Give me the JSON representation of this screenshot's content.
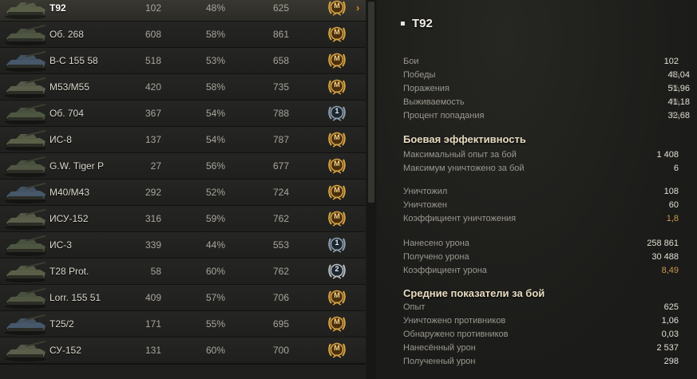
{
  "tanks": [
    {
      "name": "T92",
      "battles": "102",
      "wins": "48%",
      "xp": "625",
      "badge": "M"
    },
    {
      "name": "Об. 268",
      "battles": "608",
      "wins": "58%",
      "xp": "861",
      "badge": "M"
    },
    {
      "name": "В-С 155 58",
      "battles": "518",
      "wins": "53%",
      "xp": "658",
      "badge": "M"
    },
    {
      "name": "M53/M55",
      "battles": "420",
      "wins": "58%",
      "xp": "735",
      "badge": "M"
    },
    {
      "name": "Об. 704",
      "battles": "367",
      "wins": "54%",
      "xp": "788",
      "badge": "1"
    },
    {
      "name": "ИС-8",
      "battles": "137",
      "wins": "54%",
      "xp": "787",
      "badge": "M"
    },
    {
      "name": "G.W. Tiger P",
      "battles": "27",
      "wins": "56%",
      "xp": "677",
      "badge": "M"
    },
    {
      "name": "M40/M43",
      "battles": "292",
      "wins": "52%",
      "xp": "724",
      "badge": "M"
    },
    {
      "name": "ИСУ-152",
      "battles": "316",
      "wins": "59%",
      "xp": "762",
      "badge": "M"
    },
    {
      "name": "ИС-3",
      "battles": "339",
      "wins": "44%",
      "xp": "553",
      "badge": "1"
    },
    {
      "name": "T28 Prot.",
      "battles": "58",
      "wins": "60%",
      "xp": "762",
      "badge": "2"
    },
    {
      "name": "Lorr. 155 51",
      "battles": "409",
      "wins": "57%",
      "xp": "706",
      "badge": "M"
    },
    {
      "name": "T25/2",
      "battles": "171",
      "wins": "55%",
      "xp": "695",
      "badge": "M"
    },
    {
      "name": "СУ-152",
      "battles": "131",
      "wins": "60%",
      "xp": "700",
      "badge": "M"
    }
  ],
  "selected_arrow": "›",
  "detail": {
    "title": "T92",
    "general": [
      {
        "label": "Бои",
        "value": "102",
        "unit": ""
      },
      {
        "label": "Победы",
        "value": "48,04",
        "unit": "%"
      },
      {
        "label": "Поражения",
        "value": "51,96",
        "unit": "%"
      },
      {
        "label": "Выживаемость",
        "value": "41,18",
        "unit": "%"
      },
      {
        "label": "Процент попадания",
        "value": "32,68",
        "unit": "%"
      }
    ],
    "combat_title": "Боевая эффективность",
    "combat_a": [
      {
        "label": "Максимальный опыт за бой",
        "value": "1 408"
      },
      {
        "label": "Максимум уничтожено за бой",
        "value": "6"
      }
    ],
    "combat_b": [
      {
        "label": "Уничтожил",
        "value": "108"
      },
      {
        "label": "Уничтожен",
        "value": "60"
      },
      {
        "label": "Коэффициент уничтожения",
        "value": "1,8"
      }
    ],
    "combat_c": [
      {
        "label": "Нанесено урона",
        "value": "258 861"
      },
      {
        "label": "Получено урона",
        "value": "30 488"
      },
      {
        "label": "Коэффициент урона",
        "value": "8,49"
      }
    ],
    "avg_title": "Средние показатели за бой",
    "avg": [
      {
        "label": "Опыт",
        "value": "625"
      },
      {
        "label": "Уничтожено противников",
        "value": "1,06"
      },
      {
        "label": "Обнаружено противников",
        "value": "0,03"
      },
      {
        "label": "Нанесённый урон",
        "value": "2 537"
      },
      {
        "label": "Полученный урон",
        "value": "298"
      }
    ]
  },
  "colors": {
    "accent": "#e08a1e",
    "highlight": "#c79a4d",
    "badge_gold": "#d9a441",
    "badge_silver": "#8ea0b0"
  }
}
